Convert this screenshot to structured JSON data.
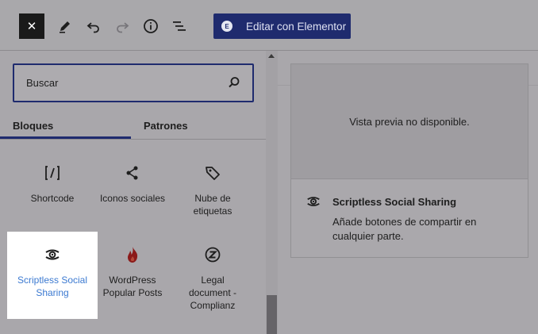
{
  "toolbar": {
    "close_label": "✕",
    "elementor_label": "Editar con Elementor",
    "elementor_badge": "E"
  },
  "inserter": {
    "search": {
      "placeholder": "Buscar"
    },
    "tabs": [
      {
        "label": "Bloques",
        "active": true
      },
      {
        "label": "Patrones",
        "active": false
      }
    ],
    "blocks": [
      {
        "label": "Shortcode",
        "icon": "shortcode-icon"
      },
      {
        "label": "Iconos sociales",
        "icon": "share-icon"
      },
      {
        "label": "Nube de etiquetas",
        "icon": "tag-icon"
      },
      {
        "label": "Scriptless Social Sharing",
        "icon": "scriptless-icon",
        "selected": true
      },
      {
        "label": "WordPress Popular Posts",
        "icon": "flame-icon"
      },
      {
        "label": "Legal document - Complianz",
        "icon": "complianz-icon"
      }
    ]
  },
  "preview": {
    "placeholder": "Vista previa no disponible.",
    "title": "Scriptless Social Sharing",
    "description": "Añade botones de compartir en cualquier parte."
  },
  "colors": {
    "accent": "#1f2b6e",
    "selected_label": "#3c7ad1",
    "flame": "#8b1a1a"
  }
}
